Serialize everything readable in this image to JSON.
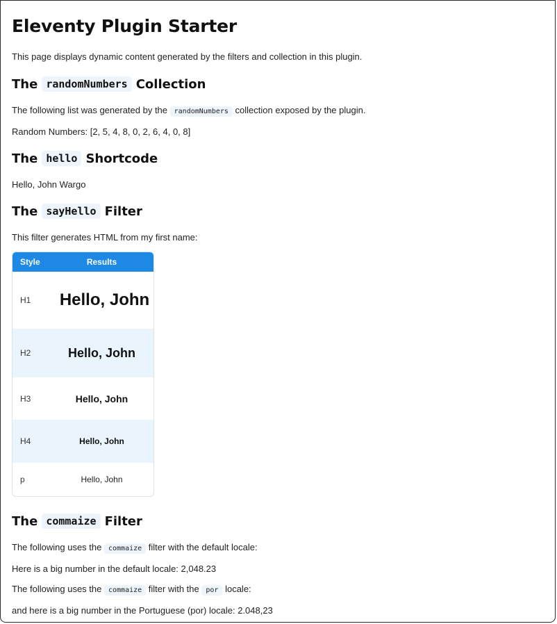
{
  "page": {
    "title": "Eleventy Plugin Starter",
    "intro": "This page displays dynamic content generated by the filters and collection in this plugin."
  },
  "random_numbers_section": {
    "heading_prefix": "The",
    "heading_code": "randomNumbers",
    "heading_suffix": "Collection",
    "desc_before": "The following list was generated by the",
    "desc_code": "randomNumbers",
    "desc_after": "collection exposed by the plugin.",
    "output": "Random Numbers: [2, 5, 4, 8, 0, 2, 6, 4, 0, 8]"
  },
  "hello_section": {
    "heading_prefix": "The",
    "heading_code": "hello",
    "heading_suffix": "Shortcode",
    "output": "Hello, John Wargo"
  },
  "sayhello_section": {
    "heading_prefix": "The",
    "heading_code": "sayHello",
    "heading_suffix": "Filter",
    "desc": "This filter generates HTML from my first name:",
    "table": {
      "columns": [
        "Style",
        "Results"
      ],
      "rows": [
        {
          "style": "H1",
          "result": "Hello, John"
        },
        {
          "style": "H2",
          "result": "Hello, John"
        },
        {
          "style": "H3",
          "result": "Hello, John"
        },
        {
          "style": "H4",
          "result": "Hello, John"
        },
        {
          "style": "p",
          "result": "Hello, John"
        }
      ]
    }
  },
  "commaize_section": {
    "heading_prefix": "The",
    "heading_code": "commaize",
    "heading_suffix": "Filter",
    "desc1_before": "The following uses the",
    "desc1_code": "commaize",
    "desc1_after": "filter with the default locale:",
    "output1": "Here is a big number in the default locale: 2,048.23",
    "desc2_before": "The following uses the",
    "desc2_code": "commaize",
    "desc2_middle": "filter with the",
    "desc2_code2": "por",
    "desc2_after": "locale:",
    "output2": "and here is a big number in the Portuguese (por) locale: 2.048,23"
  },
  "colors": {
    "table_header": "#1e88e5",
    "table_alt_row": "#eaf4fd",
    "code_background": "#eef4fb"
  }
}
